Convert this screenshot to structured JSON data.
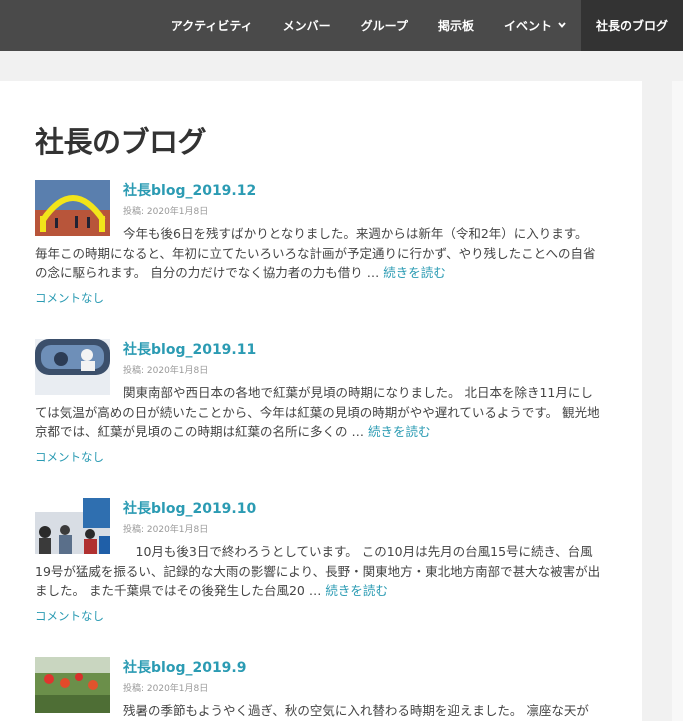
{
  "nav": {
    "items": [
      {
        "label": "アクティビティ"
      },
      {
        "label": "メンバー"
      },
      {
        "label": "グループ"
      },
      {
        "label": "掲示板"
      },
      {
        "label": "イベント"
      },
      {
        "label": "社長のブログ"
      }
    ],
    "dropdown_icon": "chevron-down-icon"
  },
  "page": {
    "title": "社長のブログ"
  },
  "posts": [
    {
      "title": "社長blog_2019.12",
      "meta": "投稿: 2020年1月8日",
      "excerpt": "今年も後6日を残すばかりとなりました。来週からは新年（令和2年）に入ります。　毎年この時期になると、年初に立てたいろいろな計画が予定通りに行かず、やり残したことへの自省の念に駆られます。 自分の力だけでなく協力者の力も借り …",
      "more": "続きを読む",
      "comments": "コメントなし"
    },
    {
      "title": "社長blog_2019.11",
      "meta": "投稿: 2020年1月8日",
      "excerpt": "関東南部や西日本の各地で紅葉が見頃の時期になりました。 北日本を除き11月にしては気温が高めの日が続いたことから、今年は紅葉の見頃の時期がやや遅れているようです。 観光地京都では、紅葉が見頃のこの時期は紅葉の名所に多くの …",
      "more": "続きを読む",
      "comments": "コメントなし"
    },
    {
      "title": "社長blog_2019.10",
      "meta": "投稿: 2020年1月8日",
      "excerpt": "　10月も後3日で終わろうとしています。 この10月は先月の台風15号に続き、台風19号が猛威を振るい、記録的な大雨の影響により、長野・関東地方・東北地方南部で甚大な被害が出ました。 また千葉県ではその後発生した台風20 …",
      "more": "続きを読む",
      "comments": "コメントなし"
    },
    {
      "title": "社長blog_2019.9",
      "meta": "投稿: 2020年1月8日",
      "excerpt": "残暑の季節もようやく過ぎ、秋の空気に入れ替わる時期を迎えました。 凛座な天が",
      "more": "",
      "comments": ""
    }
  ]
}
